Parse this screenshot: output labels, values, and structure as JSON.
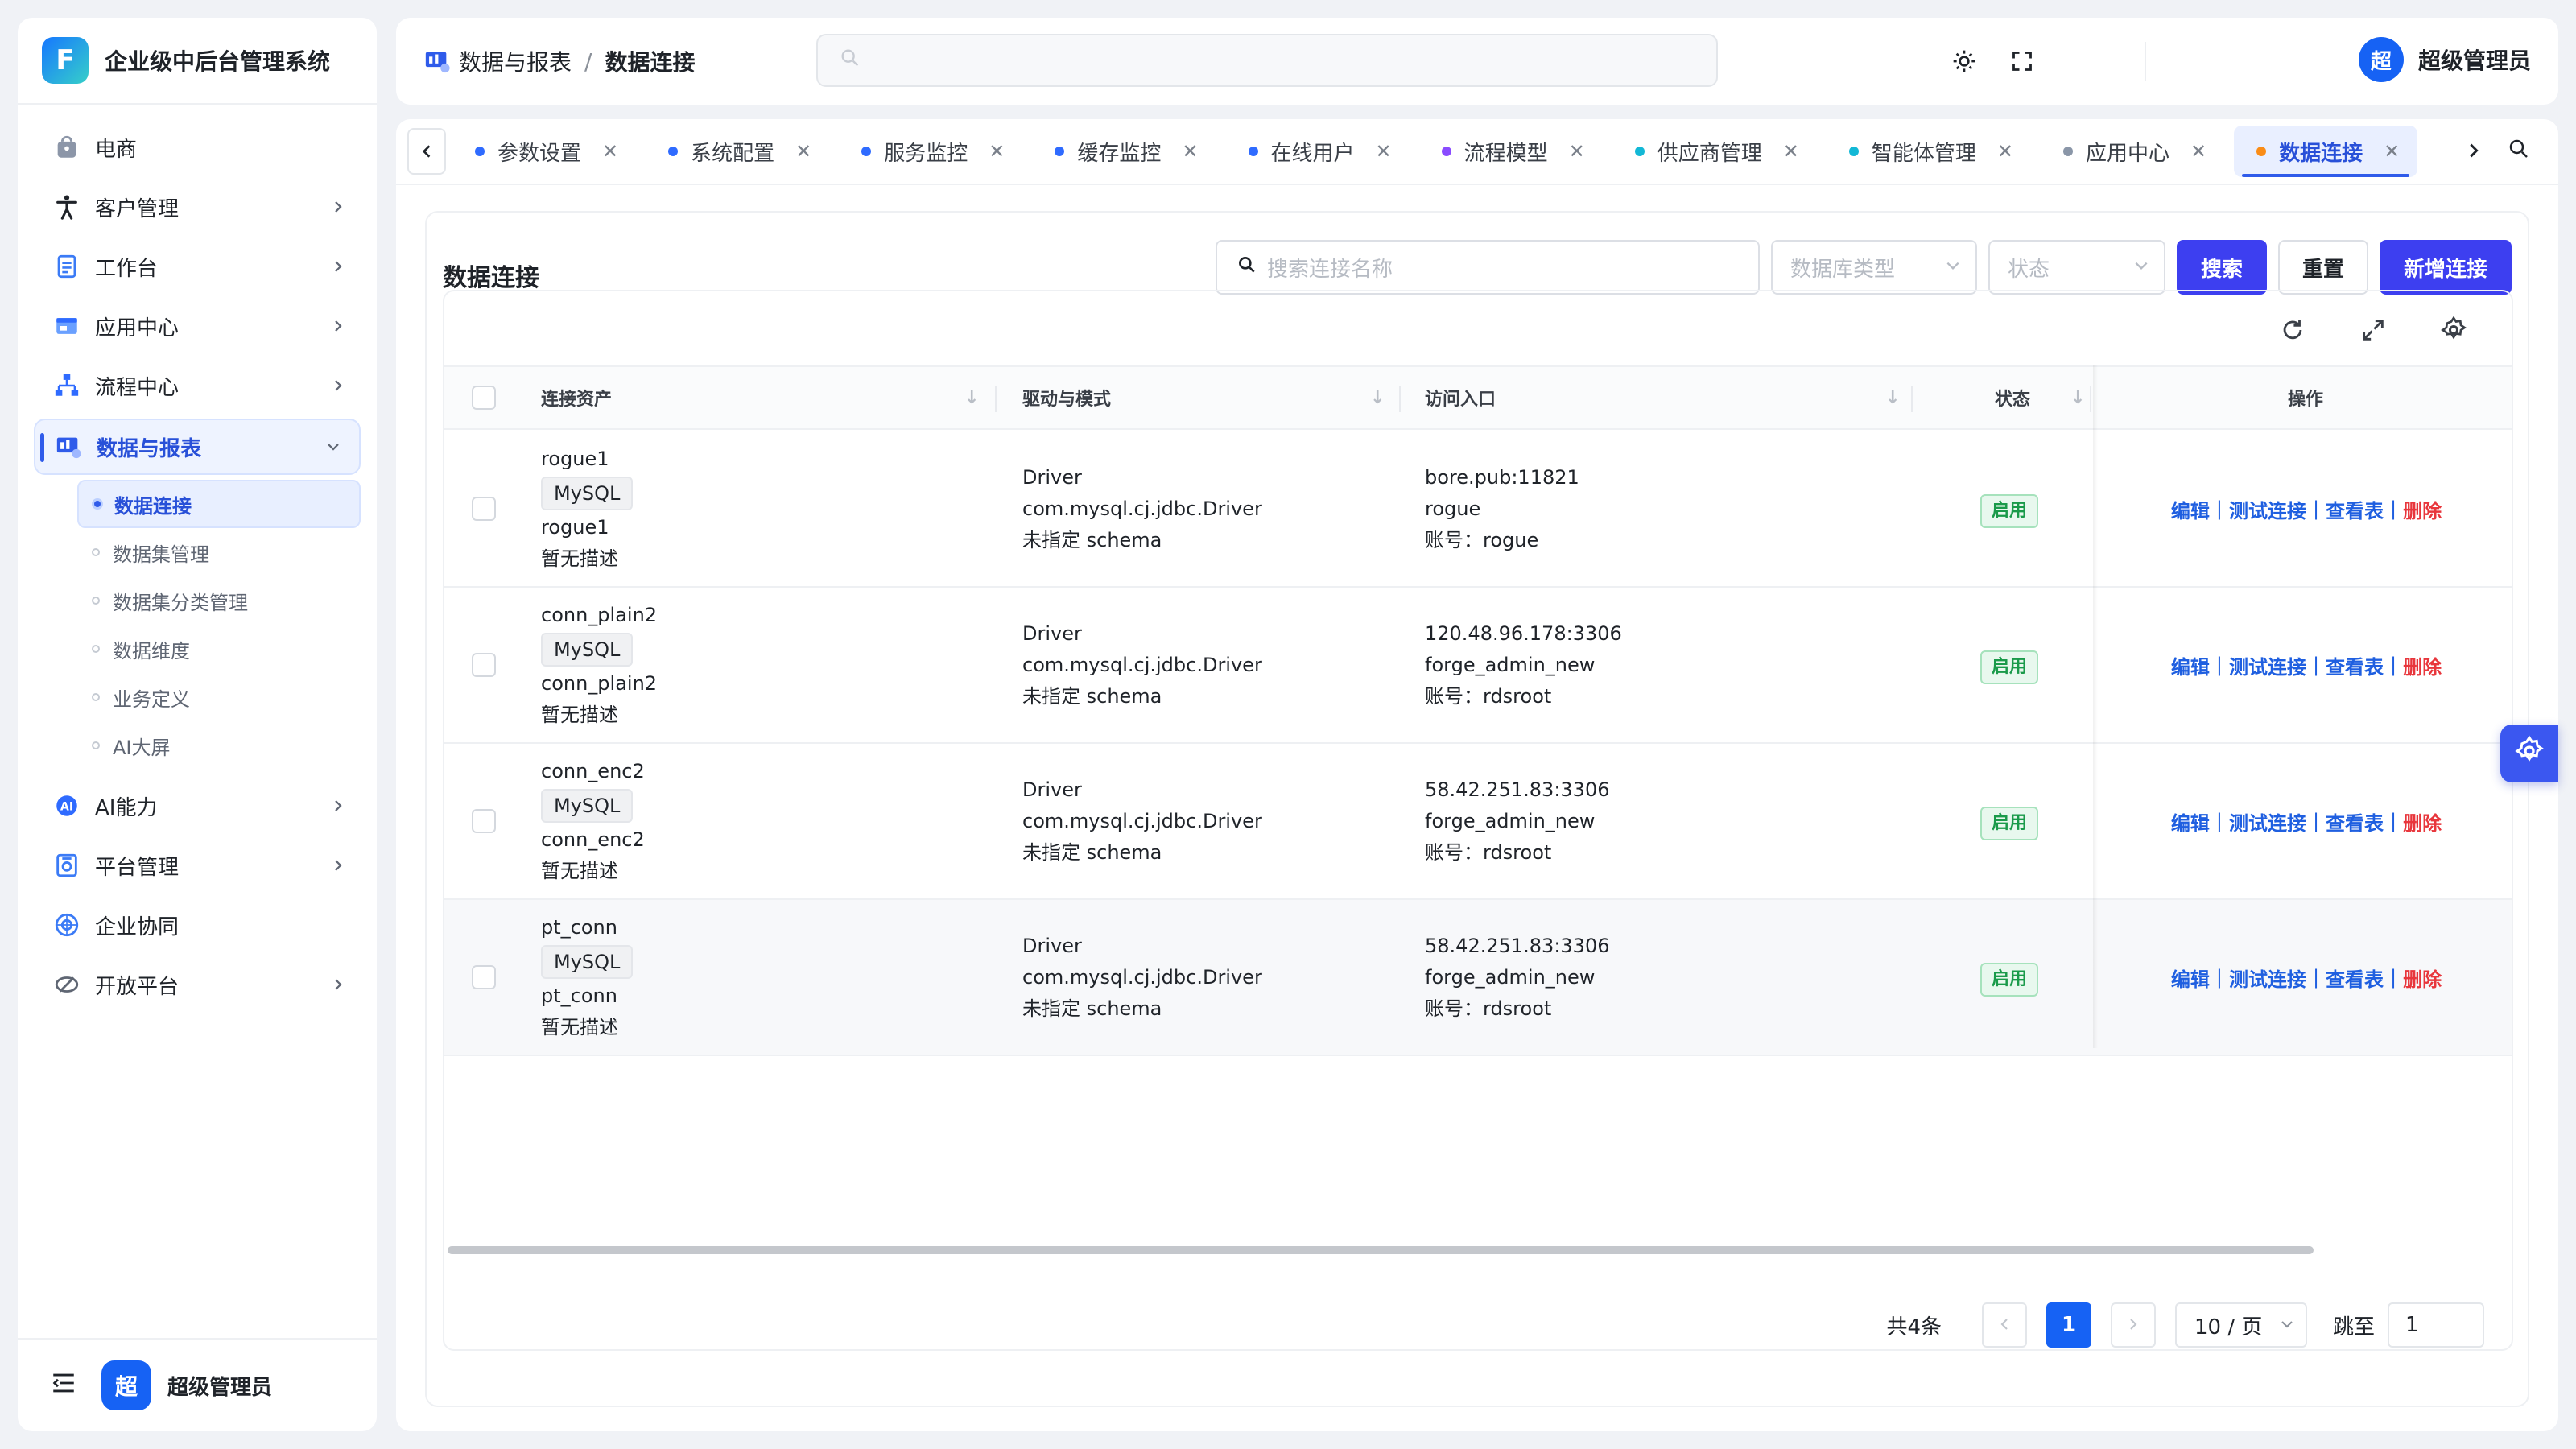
{
  "app": {
    "title": "企业级中后台管理系统",
    "logo_letter": "F"
  },
  "sidebar": {
    "items": [
      {
        "label": "电商",
        "icon": "shopping-bag-icon",
        "has_children": false
      },
      {
        "label": "客户管理",
        "icon": "person-icon",
        "has_children": true
      },
      {
        "label": "工作台",
        "icon": "clipboard-icon",
        "has_children": true
      },
      {
        "label": "应用中心",
        "icon": "app-window-icon",
        "has_children": true
      },
      {
        "label": "流程中心",
        "icon": "flow-icon",
        "has_children": true
      },
      {
        "label": "数据与报表",
        "icon": "report-icon",
        "has_children": true,
        "open": true
      },
      {
        "label": "AI能力",
        "icon": "ai-icon",
        "has_children": true
      },
      {
        "label": "平台管理",
        "icon": "platform-gear-icon",
        "has_children": true
      },
      {
        "label": "企业协同",
        "icon": "collab-icon",
        "has_children": false
      },
      {
        "label": "开放平台",
        "icon": "open-platform-icon",
        "has_children": true
      }
    ],
    "sub_items": [
      "数据连接",
      "数据集管理",
      "数据集分类管理",
      "数据维度",
      "业务定义",
      "AI大屏"
    ],
    "active_sub": "数据连接",
    "footer_user": {
      "avatar": "超",
      "name": "超级管理员"
    }
  },
  "header": {
    "breadcrumb": [
      "数据与报表",
      "数据连接"
    ],
    "search_placeholder": "",
    "user": {
      "avatar": "超",
      "name": "超级管理员"
    }
  },
  "tabs": [
    {
      "label": "参数设置",
      "dot": "#2f6bff"
    },
    {
      "label": "系统配置",
      "dot": "#2f6bff"
    },
    {
      "label": "服务监控",
      "dot": "#2f6bff"
    },
    {
      "label": "缓存监控",
      "dot": "#2f6bff"
    },
    {
      "label": "在线用户",
      "dot": "#2f6bff"
    },
    {
      "label": "流程模型",
      "dot": "#8a4bff"
    },
    {
      "label": "供应商管理",
      "dot": "#13b8d6"
    },
    {
      "label": "智能体管理",
      "dot": "#13b8d6"
    },
    {
      "label": "应用中心",
      "dot": "#8a96a8"
    },
    {
      "label": "数据连接",
      "dot": "#fa8c16",
      "active": true
    }
  ],
  "page": {
    "title": "数据连接",
    "search_placeholder": "搜索连接名称",
    "db_type_placeholder": "数据库类型",
    "status_placeholder": "状态",
    "search_btn": "搜索",
    "reset_btn": "重置",
    "add_btn": "新增连接"
  },
  "table": {
    "columns": [
      "连接资产",
      "驱动与模式",
      "访问入口",
      "状态",
      "操作"
    ],
    "rows": [
      {
        "name": "rogue1",
        "db": "MySQL",
        "alias": "rogue1",
        "desc": "暂无描述",
        "driver": "Driver",
        "driver_class": "com.mysql.cj.jdbc.Driver",
        "schema": "未指定 schema",
        "host": "bore.pub:11821",
        "database": "rogue",
        "account": "账号：rogue",
        "status": "启用"
      },
      {
        "name": "conn_plain2",
        "db": "MySQL",
        "alias": "conn_plain2",
        "desc": "暂无描述",
        "driver": "Driver",
        "driver_class": "com.mysql.cj.jdbc.Driver",
        "schema": "未指定 schema",
        "host": "120.48.96.178:3306",
        "database": "forge_admin_new",
        "account": "账号：rdsroot",
        "status": "启用"
      },
      {
        "name": "conn_enc2",
        "db": "MySQL",
        "alias": "conn_enc2",
        "desc": "暂无描述",
        "driver": "Driver",
        "driver_class": "com.mysql.cj.jdbc.Driver",
        "schema": "未指定 schema",
        "host": "58.42.251.83:3306",
        "database": "forge_admin_new",
        "account": "账号：rdsroot",
        "status": "启用"
      },
      {
        "name": "pt_conn",
        "db": "MySQL",
        "alias": "pt_conn",
        "desc": "暂无描述",
        "driver": "Driver",
        "driver_class": "com.mysql.cj.jdbc.Driver",
        "schema": "未指定 schema",
        "host": "58.42.251.83:3306",
        "database": "forge_admin_new",
        "account": "账号：rdsroot",
        "status": "启用"
      }
    ],
    "actions": {
      "edit": "编辑",
      "test": "测试连接",
      "view": "查看表",
      "delete": "删除",
      "sep": "|"
    }
  },
  "pagination": {
    "total": "共4条",
    "current": "1",
    "page_size": "10 / 页",
    "jump_label": "跳至",
    "jump_value": "1"
  },
  "colors": {
    "primary": "#3d3ff0",
    "link": "#1f5fe0",
    "danger": "#e8363c",
    "success": "#1a9a4a"
  }
}
